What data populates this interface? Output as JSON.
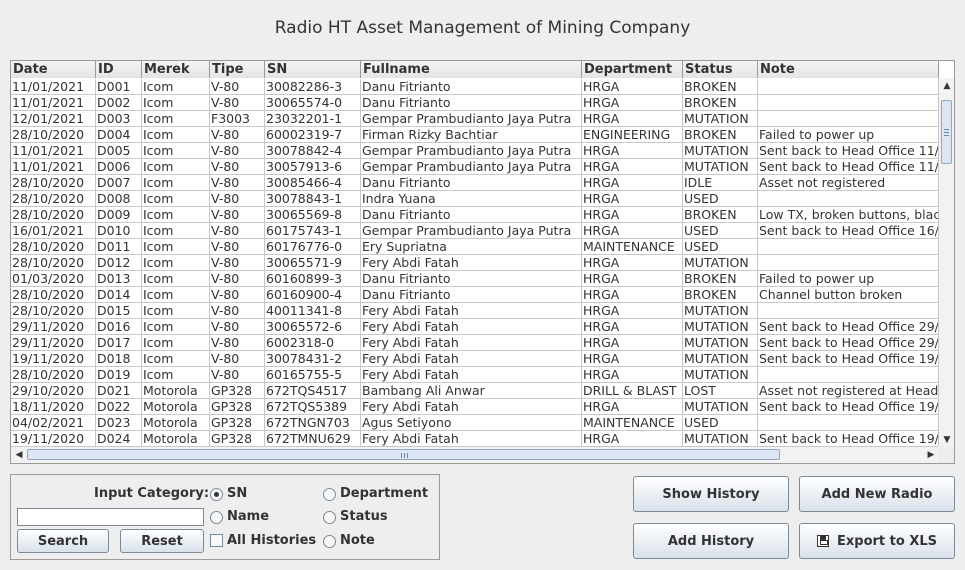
{
  "title": "Radio HT Asset Management of Mining Company",
  "table": {
    "headers": [
      "Date",
      "ID",
      "Merek",
      "Tipe",
      "SN",
      "Fullname",
      "Department",
      "Status",
      "Note"
    ],
    "rows": [
      [
        "11/01/2021",
        "D001",
        "Icom",
        "V-80",
        "30082286-3",
        "Danu Fitrianto",
        "HRGA",
        "BROKEN",
        ""
      ],
      [
        "11/01/2021",
        "D002",
        "Icom",
        "V-80",
        "30065574-0",
        "Danu Fitrianto",
        "HRGA",
        "BROKEN",
        ""
      ],
      [
        "12/01/2021",
        "D003",
        "Icom",
        "F3003",
        "23032201-1",
        "Gempar Prambudianto Jaya Putra",
        "HRGA",
        "MUTATION",
        ""
      ],
      [
        "28/10/2020",
        "D004",
        "Icom",
        "V-80",
        "60002319-7",
        "Firman Rizky Bachtiar",
        "ENGINEERING",
        "BROKEN",
        "Failed to power up"
      ],
      [
        "11/01/2021",
        "D005",
        "Icom",
        "V-80",
        "30078842-4",
        "Gempar Prambudianto Jaya Putra",
        "HRGA",
        "MUTATION",
        "Sent back to Head Office 11/"
      ],
      [
        "11/01/2021",
        "D006",
        "Icom",
        "V-80",
        "30057913-6",
        "Gempar Prambudianto Jaya Putra",
        "HRGA",
        "MUTATION",
        "Sent back to Head Office 11/"
      ],
      [
        "28/10/2020",
        "D007",
        "Icom",
        "V-80",
        "30085466-4",
        "Danu Fitrianto",
        "HRGA",
        "IDLE",
        "Asset not registered"
      ],
      [
        "28/10/2020",
        "D008",
        "Icom",
        "V-80",
        "30078843-1",
        "Indra Yuana",
        "HRGA",
        "USED",
        ""
      ],
      [
        "28/10/2020",
        "D009",
        "Icom",
        "V-80",
        "30065569-8",
        "Danu Fitrianto",
        "HRGA",
        "BROKEN",
        "Low TX, broken buttons, blac"
      ],
      [
        "16/01/2021",
        "D010",
        "Icom",
        "V-80",
        "60175743-1",
        "Gempar Prambudianto Jaya Putra",
        "HRGA",
        "USED",
        "Sent back to Head Office 16/"
      ],
      [
        "28/10/2020",
        "D011",
        "Icom",
        "V-80",
        "60176776-0",
        "Ery Supriatna",
        "MAINTENANCE",
        "USED",
        ""
      ],
      [
        "28/10/2020",
        "D012",
        "Icom",
        "V-80",
        "30065571-9",
        "Fery Abdi Fatah",
        "HRGA",
        "MUTATION",
        ""
      ],
      [
        "01/03/2020",
        "D013",
        "Icom",
        "V-80",
        "60160899-3",
        "Danu Fitrianto",
        "HRGA",
        "BROKEN",
        "Failed to power up"
      ],
      [
        "28/10/2020",
        "D014",
        "Icom",
        "V-80",
        "60160900-4",
        "Danu Fitrianto",
        "HRGA",
        "BROKEN",
        "Channel button broken"
      ],
      [
        "28/10/2020",
        "D015",
        "Icom",
        "V-80",
        "40011341-8",
        "Fery Abdi Fatah",
        "HRGA",
        "MUTATION",
        ""
      ],
      [
        "29/11/2020",
        "D016",
        "Icom",
        "V-80",
        "30065572-6",
        "Fery Abdi Fatah",
        "HRGA",
        "MUTATION",
        "Sent back to Head Office 29/"
      ],
      [
        "29/11/2020",
        "D017",
        "Icom",
        "V-80",
        "6002318-0",
        "Fery Abdi Fatah",
        "HRGA",
        "MUTATION",
        "Sent back to Head Office 29/"
      ],
      [
        "19/11/2020",
        "D018",
        "Icom",
        "V-80",
        "30078431-2",
        "Fery Abdi Fatah",
        "HRGA",
        "MUTATION",
        "Sent back to Head Office 19/"
      ],
      [
        "28/10/2020",
        "D019",
        "Icom",
        "V-80",
        "60165755-5",
        "Fery Abdi Fatah",
        "HRGA",
        "MUTATION",
        ""
      ],
      [
        "29/10/2020",
        "D021",
        "Motorola",
        "GP328",
        "672TQS4517",
        "Bambang Ali Anwar",
        "DRILL & BLAST",
        "LOST",
        "Asset not registered at Head"
      ],
      [
        "18/11/2020",
        "D022",
        "Motorola",
        "GP328",
        "672TQS5389",
        "Fery Abdi Fatah",
        "HRGA",
        "MUTATION",
        "Sent back to Head Office 19/"
      ],
      [
        "04/02/2021",
        "D023",
        "Motorola",
        "GP328",
        "672TNGN703",
        "Agus Setiyono",
        "MAINTENANCE",
        "USED",
        ""
      ],
      [
        "19/11/2020",
        "D024",
        "Motorola",
        "GP328",
        "672TMNU629",
        "Fery Abdi Fatah",
        "HRGA",
        "MUTATION",
        "Sent back to Head Office 19/"
      ]
    ]
  },
  "search_panel": {
    "input_category_label": "Input Category:",
    "options": {
      "sn": "SN",
      "department": "Department",
      "name": "Name",
      "status": "Status",
      "note": "Note"
    },
    "selected": "SN",
    "all_histories_label": "All Histories",
    "search_value": "",
    "search_button": "Search",
    "reset_button": "Reset"
  },
  "actions": {
    "show_history": "Show History",
    "add_new_radio": "Add New Radio",
    "add_history": "Add History",
    "export_xls": "Export to XLS"
  }
}
